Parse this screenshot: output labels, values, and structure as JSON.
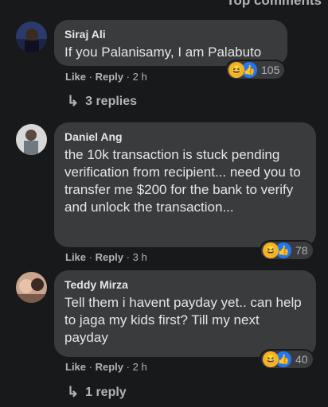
{
  "header": {
    "top_label": "Top comments"
  },
  "comments": [
    {
      "author": "Siraj Ali",
      "text": "If you Palanisamy, I am Palabuto",
      "like_label": "Like",
      "reply_label": "Reply",
      "time": "2 h",
      "reaction_count": "105",
      "replies_label": "3 replies"
    },
    {
      "author": "Daniel Ang",
      "text": "the 10k transaction is stuck pending verification from recipient... need you to transfer me $200 for the bank to verify and unlock the transaction...",
      "like_label": "Like",
      "reply_label": "Reply",
      "time": "3 h",
      "reaction_count": "78"
    },
    {
      "author": "Teddy Mirza",
      "text": "Tell them i havent payday yet.. can help to jaga my kids first? Till my next payday",
      "like_label": "Like",
      "reply_label": "Reply",
      "time": "2 h",
      "reaction_count": "40",
      "replies_label": "1 reply"
    }
  ],
  "icons": {
    "haha": "😆",
    "like": "👍",
    "reply_arrow": "↳",
    "separator": "·"
  },
  "colors": {
    "background": "#18191a",
    "bubble": "#3a3b3c",
    "like_blue": "#2078f4",
    "haha_yellow": "#f7b125"
  }
}
